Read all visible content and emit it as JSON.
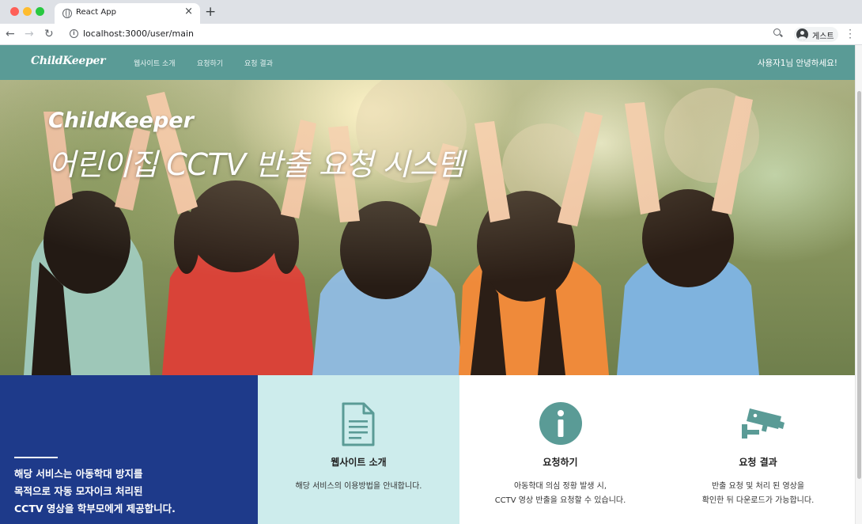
{
  "browser": {
    "tab_title": "React App",
    "url": "localhost:3000/user/main",
    "profile_label": "게스트"
  },
  "site": {
    "logo": "ChildKeeper",
    "nav": [
      "웹사이트 소개",
      "요청하기",
      "요청 결과"
    ],
    "greeting": "사용자1님 안녕하세요!"
  },
  "hero": {
    "brand": "ChildKeeper",
    "title": "어린이집 CCTV 반출 요청 시스템"
  },
  "about": {
    "lines": [
      "해당 서비스는 아동학대 방지를",
      "목적으로 자동 모자이크 처리된",
      "CCTV 영상을 학부모에게 제공합니다."
    ]
  },
  "cards": [
    {
      "icon": "document-icon",
      "title": "웹사이트 소개",
      "desc": [
        "해당 서비스의 이용방법을 안내합니다."
      ]
    },
    {
      "icon": "info-icon",
      "title": "요청하기",
      "desc": [
        "아동학대 의심 정황 발생 시,",
        "CCTV 영상 반출을 요청할 수 있습니다."
      ]
    },
    {
      "icon": "cctv-camera-icon",
      "title": "요청 결과",
      "desc": [
        "반출 요청 및 처리 된 영상을",
        "확인한 뒤 다운로드가 가능합니다."
      ]
    }
  ],
  "colors": {
    "nav_bg": "#5a9b96",
    "about_bg": "#1e3a8a",
    "card_highlight_bg": "#cdecec",
    "icon_color": "#5a9b96"
  }
}
